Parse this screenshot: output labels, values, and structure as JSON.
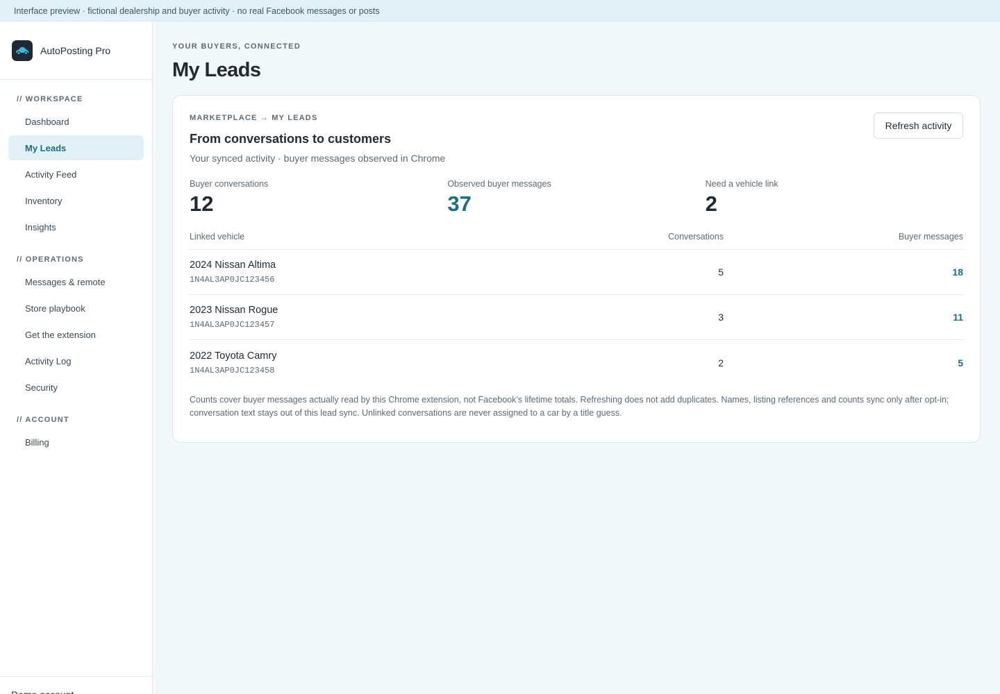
{
  "banner": {
    "text": "Interface preview · fictional dealership and buyer activity · no real Facebook messages or posts"
  },
  "brand": {
    "name": "AutoPosting Pro",
    "logo_icon": "car-icon"
  },
  "sidebar": {
    "sections": [
      {
        "label": "// WORKSPACE"
      },
      {
        "label": "// OPERATIONS"
      },
      {
        "label": "// ACCOUNT"
      }
    ],
    "items": [
      {
        "label": "Dashboard"
      },
      {
        "label": "My Leads",
        "active": true
      },
      {
        "label": "Activity Feed"
      },
      {
        "label": "Inventory"
      },
      {
        "label": "Insights"
      },
      {
        "label": "Messages & remote"
      },
      {
        "label": "Store playbook"
      },
      {
        "label": "Get the extension"
      },
      {
        "label": "Activity Log"
      },
      {
        "label": "Security"
      },
      {
        "label": "Billing"
      }
    ],
    "footer_text": "Demo account"
  },
  "page": {
    "eyebrow": "YOUR BUYERS, CONNECTED",
    "title": "My Leads"
  },
  "card": {
    "eyebrow": "MARKETPLACE → MY LEADS",
    "title": "From conversations to customers",
    "subtitle": "Your synced activity · buyer messages observed in Chrome",
    "refresh_label": "Refresh activity",
    "stats": [
      {
        "label": "Buyer conversations",
        "value": "12"
      },
      {
        "label": "Observed buyer messages",
        "value": "37"
      },
      {
        "label": "Need a vehicle link",
        "value": "2"
      }
    ],
    "table": {
      "headers": [
        "Linked vehicle",
        "Conversations",
        "Buyer messages"
      ],
      "rows": [
        {
          "vehicle": "2024 Nissan Altima",
          "vin": "1N4AL3AP0JC123456",
          "conversations": "5",
          "messages": "18"
        },
        {
          "vehicle": "2023 Nissan Rogue",
          "vin": "1N4AL3AP0JC123457",
          "conversations": "3",
          "messages": "11"
        },
        {
          "vehicle": "2022 Toyota Camry",
          "vin": "1N4AL3AP0JC123458",
          "conversations": "2",
          "messages": "5"
        }
      ]
    },
    "footnote": "Counts cover buyer messages actually read by this Chrome extension, not Facebook’s lifetime totals. Refreshing does not add duplicates. Names, listing references and counts sync only after opt-in; conversation text stays out of this lead sync. Unlinked conversations are never assigned to a car by a title guess."
  },
  "colors": {
    "accent": "#1d6d84",
    "active_bg": "#e2f1f8",
    "banner_bg": "#e2f1f8",
    "logo_bg": "#1d2a33",
    "car": "#3fb6d6"
  }
}
